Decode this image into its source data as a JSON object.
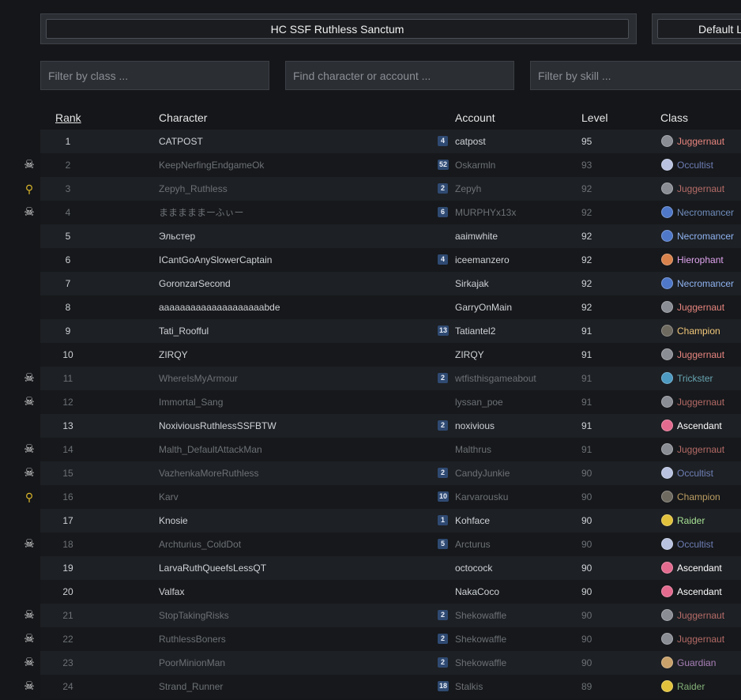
{
  "leagues": {
    "selected": "HC SSF Ruthless Sanctum",
    "second": "Default L"
  },
  "filters": {
    "class_placeholder": "Filter by class ...",
    "character_placeholder": "Find character or account ...",
    "skill_placeholder": "Filter by skill ..."
  },
  "table": {
    "headers": {
      "rank": "Rank",
      "character": "Character",
      "account": "Account",
      "level": "Level",
      "class": "Class"
    },
    "colors": {
      "Juggernaut": "#e8857f",
      "Occultist": "#8a9fe6",
      "Necromancer": "#8fb3f2",
      "Hierophant": "#e0a4ef",
      "Champion": "#f2c87a",
      "Trickster": "#7fd0e0",
      "Ascendant": "#ffffff",
      "Raider": "#a6e095",
      "Guardian": "#d7a0e8"
    },
    "icon_colors": {
      "Juggernaut": "#8a8d94",
      "Occultist": "#b9c3e0",
      "Necromancer": "#4f78c8",
      "Hierophant": "#d9824c",
      "Champion": "#6e6a60",
      "Trickster": "#4d9ac2",
      "Ascendant": "#e36b8f",
      "Raider": "#e2c23c",
      "Guardian": "#c9a16a"
    },
    "rows": [
      {
        "rank": "1",
        "character": "CATPOST",
        "badge": "4",
        "account": "catpost",
        "level": "95",
        "class": "Juggernaut",
        "status": ""
      },
      {
        "rank": "2",
        "character": "KeepNerfingEndgameOk",
        "badge": "52",
        "account": "Oskarmln",
        "level": "93",
        "class": "Occultist",
        "status": "dead"
      },
      {
        "rank": "3",
        "character": "Zepyh_Ruthless",
        "badge": "2",
        "account": "Zepyh",
        "level": "92",
        "class": "Juggernaut",
        "status": "retired"
      },
      {
        "rank": "4",
        "character": "まままままーふぃー",
        "badge": "6",
        "account": "MURPHYx13x",
        "level": "92",
        "class": "Necromancer",
        "status": "dead"
      },
      {
        "rank": "5",
        "character": "Эльстер",
        "badge": "",
        "account": "aaimwhite",
        "level": "92",
        "class": "Necromancer",
        "status": ""
      },
      {
        "rank": "6",
        "character": "ICantGoAnySlowerCaptain",
        "badge": "4",
        "account": "iceemanzero",
        "level": "92",
        "class": "Hierophant",
        "status": ""
      },
      {
        "rank": "7",
        "character": "GoronzarSecond",
        "badge": "",
        "account": "Sirkajak",
        "level": "92",
        "class": "Necromancer",
        "status": ""
      },
      {
        "rank": "8",
        "character": "aaaaaaaaaaaaaaaaaaaabde",
        "badge": "",
        "account": "GarryOnMain",
        "level": "92",
        "class": "Juggernaut",
        "status": ""
      },
      {
        "rank": "9",
        "character": "Tati_Roofful",
        "badge": "13",
        "account": "Tatiantel2",
        "level": "91",
        "class": "Champion",
        "status": ""
      },
      {
        "rank": "10",
        "character": "ZIRQY",
        "badge": "",
        "account": "ZIRQY",
        "level": "91",
        "class": "Juggernaut",
        "status": ""
      },
      {
        "rank": "11",
        "character": "WhereIsMyArmour",
        "badge": "2",
        "account": "wtfisthisgameabout",
        "level": "91",
        "class": "Trickster",
        "status": "dead"
      },
      {
        "rank": "12",
        "character": "Immortal_Sang",
        "badge": "",
        "account": "lyssan_poe",
        "level": "91",
        "class": "Juggernaut",
        "status": "dead"
      },
      {
        "rank": "13",
        "character": "NoxiviousRuthlessSSFBTW",
        "badge": "2",
        "account": "noxivious",
        "level": "91",
        "class": "Ascendant",
        "status": ""
      },
      {
        "rank": "14",
        "character": "Malth_DefaultAttackMan",
        "badge": "",
        "account": "Malthrus",
        "level": "91",
        "class": "Juggernaut",
        "status": "dead"
      },
      {
        "rank": "15",
        "character": "VazhenkaMoreRuthless",
        "badge": "2",
        "account": "CandyJunkie",
        "level": "90",
        "class": "Occultist",
        "status": "dead"
      },
      {
        "rank": "16",
        "character": "Karv",
        "badge": "10",
        "account": "Karvarousku",
        "level": "90",
        "class": "Champion",
        "status": "retired"
      },
      {
        "rank": "17",
        "character": "Knosie",
        "badge": "1",
        "account": "Kohface",
        "level": "90",
        "class": "Raider",
        "status": ""
      },
      {
        "rank": "18",
        "character": "Archturius_ColdDot",
        "badge": "5",
        "account": "Arcturus",
        "level": "90",
        "class": "Occultist",
        "status": "dead"
      },
      {
        "rank": "19",
        "character": "LarvaRuthQueefsLessQT",
        "badge": "",
        "account": "octocock",
        "level": "90",
        "class": "Ascendant",
        "status": ""
      },
      {
        "rank": "20",
        "character": "Valfax",
        "badge": "",
        "account": "NakaCoco",
        "level": "90",
        "class": "Ascendant",
        "status": ""
      },
      {
        "rank": "21",
        "character": "StopTakingRisks",
        "badge": "2",
        "account": "Shekowaffle",
        "level": "90",
        "class": "Juggernaut",
        "status": "dead"
      },
      {
        "rank": "22",
        "character": "RuthlessBoners",
        "badge": "2",
        "account": "Shekowaffle",
        "level": "90",
        "class": "Juggernaut",
        "status": "dead"
      },
      {
        "rank": "23",
        "character": "PoorMinionMan",
        "badge": "2",
        "account": "Shekowaffle",
        "level": "90",
        "class": "Guardian",
        "status": "dead"
      },
      {
        "rank": "24",
        "character": "Strand_Runner",
        "badge": "18",
        "account": "Stalkis",
        "level": "89",
        "class": "Raider",
        "status": "dead"
      }
    ]
  }
}
